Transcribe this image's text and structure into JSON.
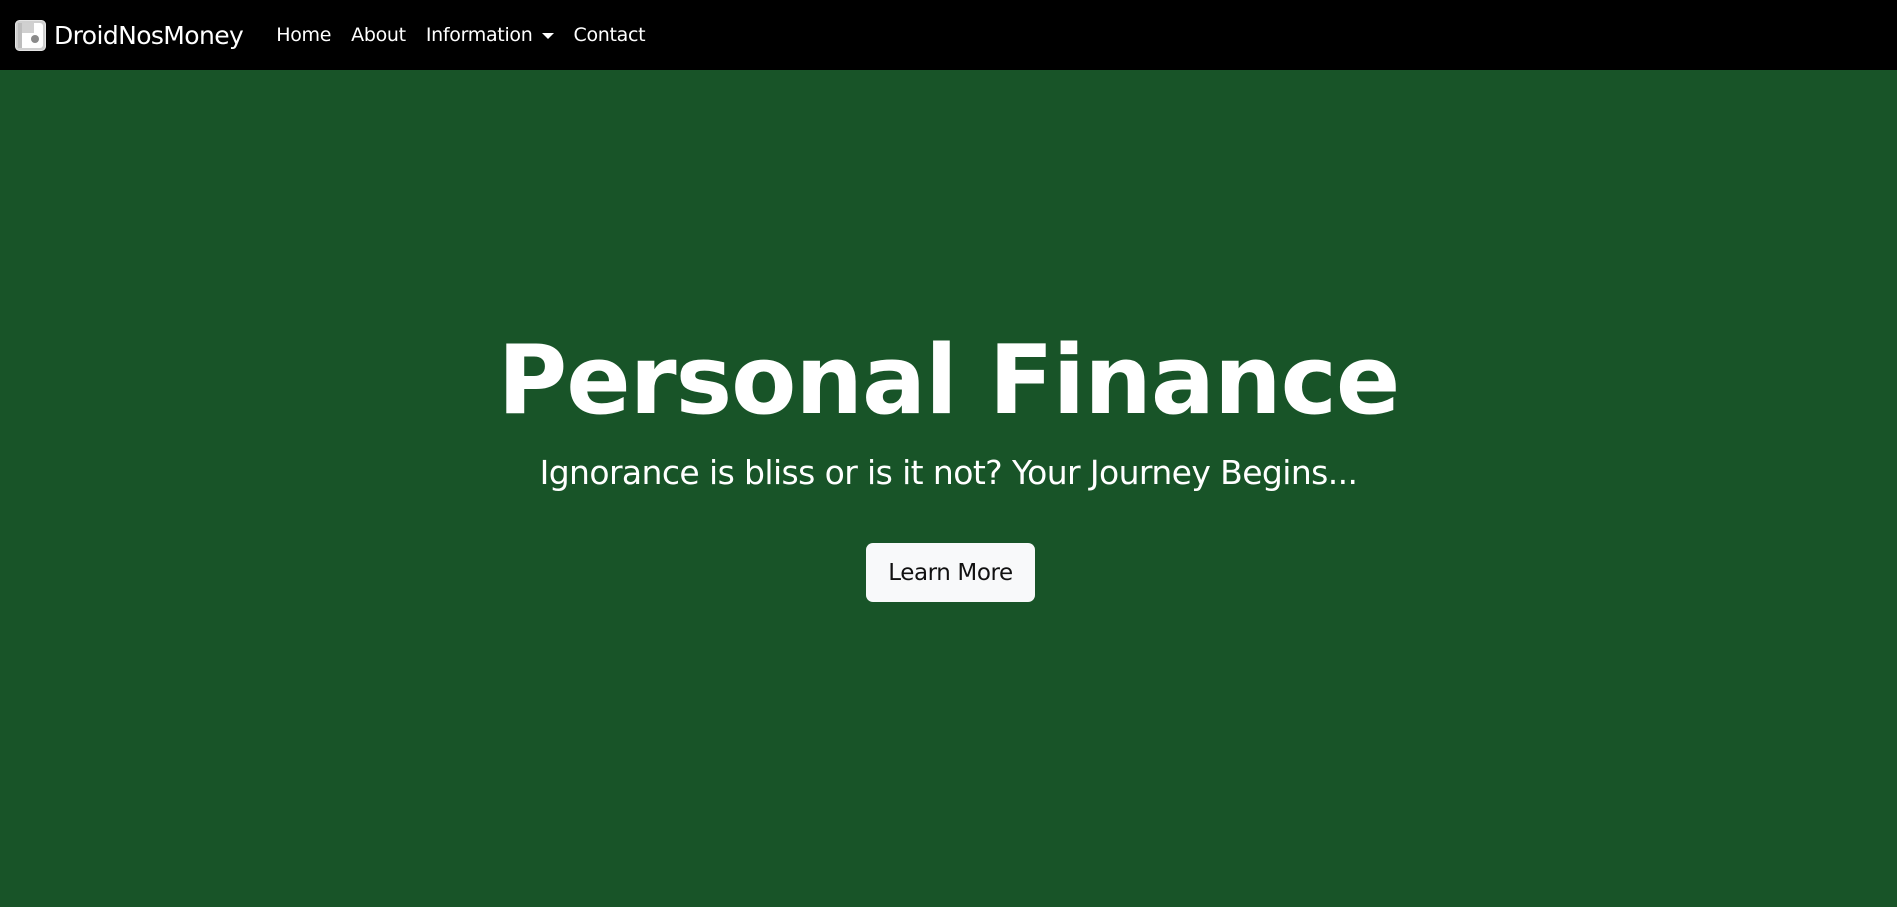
{
  "navbar": {
    "brand_name": "DroidNosMoney",
    "logo_icon": "droid-logo-icon",
    "links": [
      {
        "label": "Home"
      },
      {
        "label": "About"
      },
      {
        "label": "Information",
        "dropdown": true
      },
      {
        "label": "Contact"
      }
    ]
  },
  "hero": {
    "title": "Personal Finance",
    "subtitle": "Ignorance is bliss or is it not? Your Journey Begins...",
    "button_label": "Learn More"
  },
  "colors": {
    "navbar_background": "#000000",
    "hero_background": "#185428",
    "text": "#ffffff",
    "button_background": "#f8f9fa"
  }
}
